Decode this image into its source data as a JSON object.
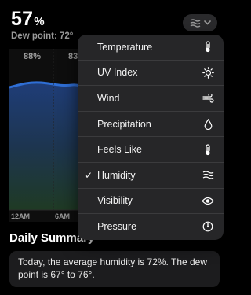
{
  "header": {
    "value": "57",
    "unit": "%",
    "dew_point": "Dew point: 72°"
  },
  "chart": {
    "top_labels": [
      "88%",
      "83"
    ],
    "time_labels": [
      "12AM",
      "6AM"
    ],
    "line_color": "#2f6fd6",
    "fill_top_color": "#1f3d78",
    "fill_bottom_color": "#1f3a24"
  },
  "menu": {
    "items": [
      {
        "label": "Temperature",
        "icon": "thermometer-icon",
        "checked": false
      },
      {
        "label": "UV Index",
        "icon": "sun-icon",
        "checked": false
      },
      {
        "label": "Wind",
        "icon": "wind-icon",
        "checked": false
      },
      {
        "label": "Precipitation",
        "icon": "drop-icon",
        "checked": false
      },
      {
        "label": "Feels Like",
        "icon": "thermometer-icon",
        "checked": false
      },
      {
        "label": "Humidity",
        "icon": "humidity-icon",
        "checked": true
      },
      {
        "label": "Visibility",
        "icon": "eye-icon",
        "checked": false
      },
      {
        "label": "Pressure",
        "icon": "gauge-icon",
        "checked": false
      }
    ],
    "check_glyph": "✓"
  },
  "summary": {
    "title": "Daily Summary",
    "text": "Today, the average humidity is 72%. The dew point is 67° to 76°."
  }
}
